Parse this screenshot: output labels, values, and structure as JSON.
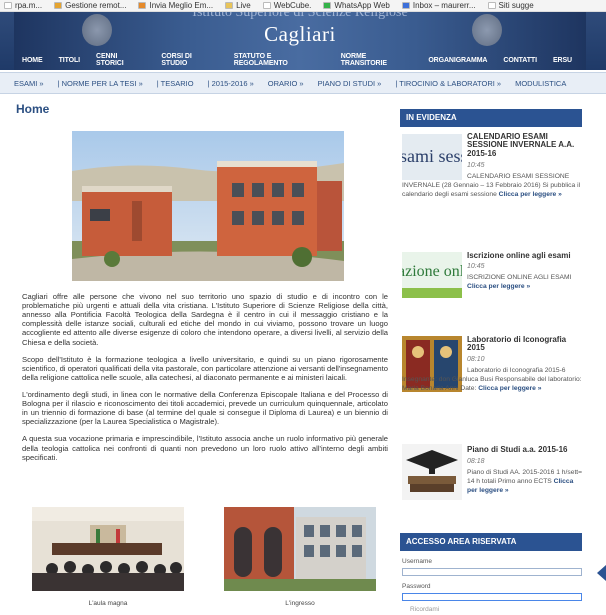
{
  "bookmarks": [
    {
      "label": "rpa.m...",
      "icon": "page-icon",
      "color": "#ffffff"
    },
    {
      "label": "Gestione remot...",
      "icon": "app-icon",
      "color": "#e5a430"
    },
    {
      "label": "Invia Meglio Em...",
      "icon": "app-icon",
      "color": "#e58a2b"
    },
    {
      "label": "Live",
      "icon": "folder-icon",
      "color": "#e8c45a"
    },
    {
      "label": "WebCube.",
      "icon": "page-icon",
      "color": "#ffffff"
    },
    {
      "label": "WhatsApp Web",
      "icon": "app-icon",
      "color": "#35b34a"
    },
    {
      "label": "Inbox – maurerr...",
      "icon": "mail-icon",
      "color": "#3d6fd9"
    },
    {
      "label": "Siti sugge",
      "icon": "page-icon",
      "color": "#ffffff"
    }
  ],
  "header": {
    "subtitle": "Istituto Superiore di Scienze Religiose",
    "title": "Cagliari"
  },
  "main_nav": [
    "HOME",
    "TITOLI",
    "CENNI STORICI",
    "CORSI DI STUDIO",
    "STATUTO E REGOLAMENTO",
    "NORME TRANSITORIE",
    "ORGANIGRAMMA",
    "CONTATTI",
    "ERSU"
  ],
  "sub_nav": [
    "ESAMI »",
    "| NORME PER LA TESI »",
    "| TESARIO",
    "| 2015-2016 »",
    "ORARIO »",
    "PIANO DI STUDI »",
    "| TIROCINIO & LABORATORI »",
    "MODULISTICA"
  ],
  "page": {
    "title": "Home",
    "paragraphs": [
      "Cagliari offre alle persone che vivono nel suo territorio uno spazio di studio e di incontro con le problematiche più urgenti e attuali della vita cristiana. L'Istituto Superiore di Scienze Religiose della città, annesso alla Pontificia Facoltà Teologica della Sardegna è il centro in cui il messaggio cristiano e la complessità delle istanze sociali, culturali ed etiche del mondo in cui viviamo, possono trovare un luogo accogliente ed attento alle diverse esigenze di coloro che intendono operare, a diversi livelli, al servizio della Chiesa e della società.",
      "Scopo dell'Istituto è la formazione teologica a livello universitario, e quindi su un piano rigorosamente scientifico, di operatori qualificati della vita pastorale, con particolare attenzione ai versanti dell'insegnamento della religione cattolica nelle scuole, alla catechesi, al diaconato permanente e ai ministeri laicali.",
      "L'ordinamento degli studi, in linea con le normative della Conferenza Episcopale Italiana e del Processo di Bologna per il rilascio e riconoscimento dei titoli accademici, prevede un curriculum quinquennale, articolato in un triennio di formazione di base (al termine del quale si consegue il Diploma di Laurea) e un biennio di specializzazione (per la Laurea Specialistica o Magistrale).",
      "A questa sua vocazione primaria e imprescindibile, l'Istituto associa anche un ruolo informativo più generale della teologia cattolica nei confronti di quanti non prevedono un loro ruolo attivo all'interno degli ambiti specificati."
    ],
    "captions": [
      "L'aula magna",
      "L'ingresso"
    ]
  },
  "sidebar": {
    "evidenza_title": "IN EVIDENZA",
    "news": [
      {
        "title": "CALENDARIO ESAMI SESSIONE INVERNALE A.A. 2015-16",
        "time": "10:45",
        "body": "CALENDARIO ESAMI SESSIONE INVERNALE (28 Gennaio – 13 Febbraio 2016) Si pubblica il calendario degli esami sessione",
        "more": "Clicca per leggere »",
        "thumb_text": "sami sessio"
      },
      {
        "title": "Iscrizione online agli esami",
        "time": "10:45",
        "body": "ISCRIZIONE ONLINE AGLI ESAMI",
        "more": "Clicca per leggere »",
        "thumb_text": "azione onlin"
      },
      {
        "title": "Laboratorio di Iconografia 2015",
        "time": "08:10",
        "body": "Laboratorio di Iconografia 2015-6 Insegnante: don Gianluca Busi Responsabile del laboratorio: Maria Bonaria Anni Date:",
        "more": "Clicca per leggere »"
      },
      {
        "title": "Piano di Studi a.a. 2015-16",
        "time": "08:18",
        "body": "Piano di Studi AA. 2015-2016 1 h/sett= 14 h totali Primo anno ECTS",
        "more": "Clicca per leggere »"
      }
    ],
    "login_title": "ACCESSO AREA RISERVATA",
    "username_label": "Username",
    "password_label": "Password",
    "remember_label": "Ricordami"
  },
  "colors": {
    "brand": "#2b5392",
    "link": "#2b4f82",
    "header": "#1f3a68"
  }
}
